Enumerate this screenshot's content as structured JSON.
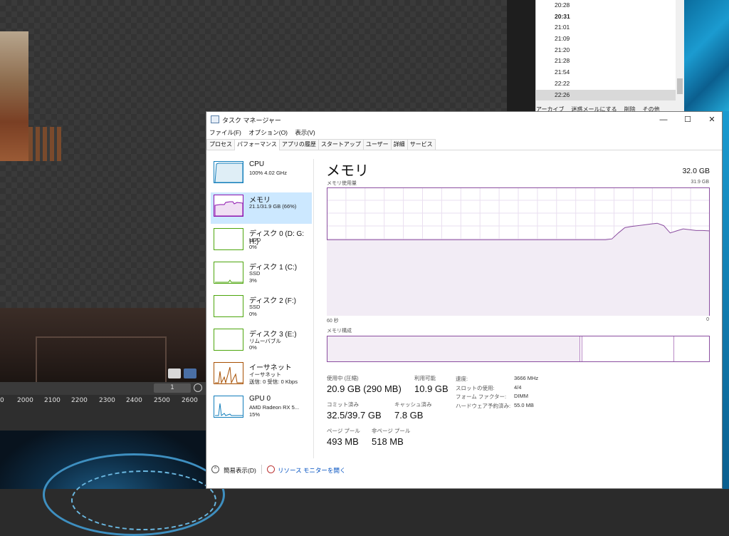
{
  "background": {
    "timeline_ticks": [
      "0",
      "2000",
      "2100",
      "2200",
      "2300",
      "2400",
      "2500",
      "2600"
    ],
    "frame_value": "1",
    "time_list": [
      "20:28",
      "20:31",
      "21:01",
      "21:09",
      "21:20",
      "21:28",
      "21:54",
      "22:22",
      "22:26"
    ],
    "time_list_bold_index": 1,
    "time_list_selected_index": 8,
    "time_window_buttons": [
      "アーカイブ",
      "迷惑メールにする",
      "削除",
      "その他"
    ]
  },
  "task_manager": {
    "title": "タスク マネージャー",
    "window_controls": {
      "minimize": "—",
      "maximize": "☐",
      "close": "✕"
    },
    "menu": [
      "ファイル(F)",
      "オプション(O)",
      "表示(V)"
    ],
    "tabs": [
      "プロセス",
      "パフォーマンス",
      "アプリの履歴",
      "スタートアップ",
      "ユーザー",
      "詳細",
      "サービス"
    ],
    "active_tab_index": 1,
    "sidebar": [
      {
        "name": "CPU",
        "sub1": "100%  4.02 GHz",
        "sub2": "",
        "color": "#117dbb"
      },
      {
        "name": "メモリ",
        "sub1": "21.1/31.9 GB (66%)",
        "sub2": "",
        "color": "#8b12ae"
      },
      {
        "name": "ディスク 0 (D: G: H:)",
        "sub1": "HDD",
        "sub2": "0%",
        "color": "#4da60c"
      },
      {
        "name": "ディスク 1 (C:)",
        "sub1": "SSD",
        "sub2": "3%",
        "color": "#4da60c"
      },
      {
        "name": "ディスク 2 (F:)",
        "sub1": "SSD",
        "sub2": "0%",
        "color": "#4da60c"
      },
      {
        "name": "ディスク 3 (E:)",
        "sub1": "リムーバブル",
        "sub2": "0%",
        "color": "#4da60c"
      },
      {
        "name": "イーサネット",
        "sub1": "イーサネット",
        "sub2": "送信: 0 受信: 0 Kbps",
        "color": "#a74f01"
      },
      {
        "name": "GPU 0",
        "sub1": "AMD Radeon RX 5...",
        "sub2": "15%",
        "color": "#117dbb"
      }
    ],
    "active_sidebar_index": 1,
    "memory": {
      "title": "メモリ",
      "total": "32.0 GB",
      "usage_label": "メモリ使用量",
      "usage_max": "31.9 GB",
      "axis_left": "60 秒",
      "axis_right": "0",
      "composition_label": "メモリ構成",
      "usage_history_gb": [
        18.9,
        18.9,
        18.9,
        18.9,
        18.9,
        18.9,
        18.9,
        18.9,
        18.9,
        18.9,
        18.9,
        18.9,
        18.9,
        18.9,
        18.9,
        18.9,
        18.9,
        18.9,
        18.9,
        18.9,
        18.9,
        18.9,
        18.9,
        18.9,
        18.9,
        18.9,
        18.9,
        18.9,
        18.9,
        18.9,
        18.9,
        18.9,
        18.9,
        18.9,
        18.9,
        18.9,
        18.9,
        18.9,
        18.9,
        18.9,
        18.9,
        18.9,
        18.9,
        18.9,
        19.1,
        20.6,
        21.9,
        22.2,
        22.4,
        22.6,
        22.8,
        23.0,
        22.4,
        20.6,
        21.1,
        21.6,
        21.4,
        21.2,
        21.2,
        21.1
      ],
      "composition_in_use_fraction": 0.66,
      "composition_modified_fraction": 0.005,
      "composition_standby_fraction": 0.24,
      "stats": {
        "in_use_label": "使用中 (圧縮)",
        "in_use": "20.9 GB (290 MB)",
        "available_label": "利用可能",
        "available": "10.9 GB",
        "committed_label": "コミット済み",
        "committed": "32.5/39.7 GB",
        "cached_label": "キャッシュ済み",
        "cached": "7.8 GB",
        "paged_pool_label": "ページ プール",
        "paged_pool": "493 MB",
        "nonpaged_pool_label": "非ページ プール",
        "nonpaged_pool": "518 MB"
      },
      "specs": [
        {
          "k": "速度:",
          "v": "3666 MHz"
        },
        {
          "k": "スロットの使用:",
          "v": "4/4"
        },
        {
          "k": "フォーム ファクター:",
          "v": "DIMM"
        },
        {
          "k": "ハードウェア予約済み:",
          "v": "55.0 MB"
        }
      ]
    },
    "footer": {
      "fewer": "簡易表示(D)",
      "resmon": "リソース モニターを開く"
    }
  }
}
